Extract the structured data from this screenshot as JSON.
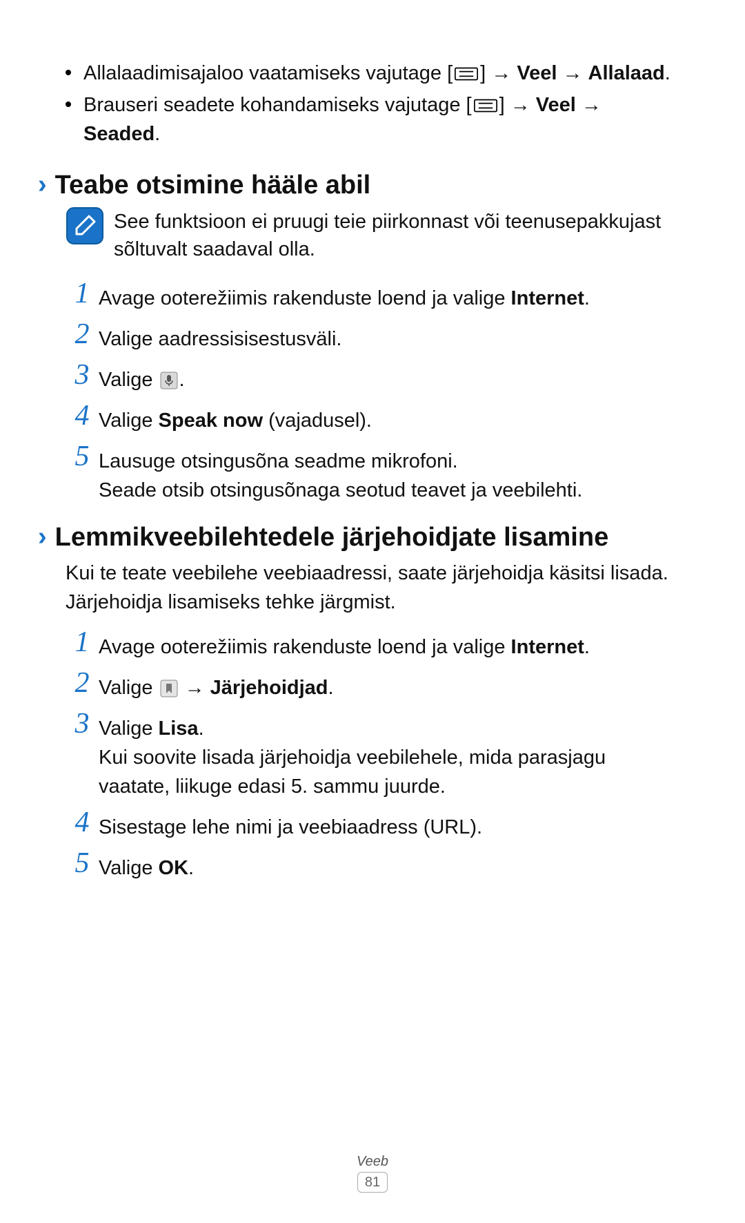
{
  "bullets": [
    {
      "pre": "Allalaadimisajaloo vaatamiseks vajutage [",
      "mid": "] → ",
      "b1": "Veel",
      "arrow2": " → ",
      "b2": "Allalaad",
      "suffix": "."
    },
    {
      "pre": "Brauseri seadete kohandamiseks vajutage [",
      "mid": "] → ",
      "b1": "Veel",
      "arrow2": " → ",
      "b2": "Seaded",
      "suffix": "."
    }
  ],
  "section1": {
    "heading": "Teabe otsimine hääle abil",
    "note": "See funktsioon ei pruugi teie piirkonnast või teenusepakkujast sõltuvalt saadaval olla.",
    "steps": [
      {
        "n": "1",
        "pre": "Avage ooterežiimis rakenduste loend ja valige ",
        "bold": "Internet",
        "post": "."
      },
      {
        "n": "2",
        "pre": "Valige aadressisisestusväli."
      },
      {
        "n": "3",
        "pre": "Valige ",
        "mic": true,
        "post": "."
      },
      {
        "n": "4",
        "pre": "Valige ",
        "bold": "Speak now",
        "post": " (vajadusel)."
      },
      {
        "n": "5",
        "pre": "Lausuge otsingusõna seadme mikrofoni.",
        "line2": "Seade otsib otsingusõnaga seotud teavet ja veebilehti."
      }
    ]
  },
  "section2": {
    "heading": "Lemmikveebilehtedele järjehoidjate lisamine",
    "intro": "Kui te teate veebilehe veebiaadressi, saate järjehoidja käsitsi lisada. Järjehoidja lisamiseks tehke järgmist.",
    "steps": [
      {
        "n": "1",
        "pre": "Avage ooterežiimis rakenduste loend ja valige ",
        "bold": "Internet",
        "post": "."
      },
      {
        "n": "2",
        "pre": "Valige ",
        "bookmark": true,
        "mid": " → ",
        "bold": "Järjehoidjad",
        "post": "."
      },
      {
        "n": "3",
        "pre": "Valige ",
        "bold": "Lisa",
        "post": ".",
        "line2": "Kui soovite lisada järjehoidja veebilehele, mida parasjagu vaatate, liikuge edasi 5. sammu juurde."
      },
      {
        "n": "4",
        "pre": "Sisestage lehe nimi ja veebiaadress (URL)."
      },
      {
        "n": "5",
        "pre": "Valige ",
        "bold": "OK",
        "post": "."
      }
    ]
  },
  "footer": {
    "label": "Veeb",
    "page": "81"
  }
}
